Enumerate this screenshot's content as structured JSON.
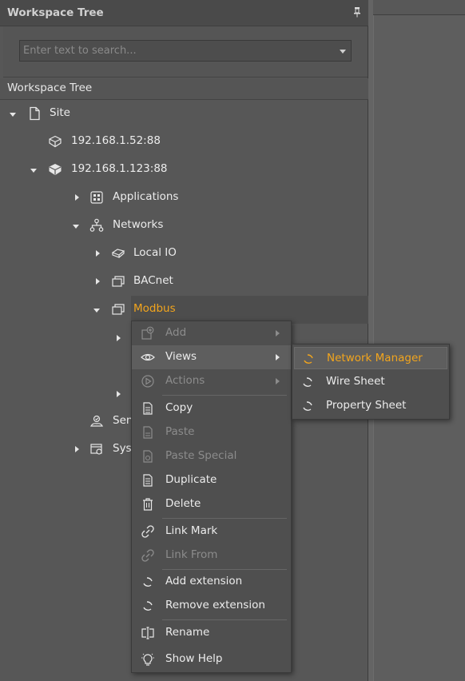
{
  "panel": {
    "title": "Workspace Tree"
  },
  "search": {
    "placeholder": "Enter text to search..."
  },
  "subheader": "Workspace Tree",
  "tree": {
    "site": "Site",
    "device1": "192.168.1.52:88",
    "device2": "192.168.1.123:88",
    "applications": "Applications",
    "networks": "Networks",
    "local_io": "Local IO",
    "bacnet": "BACnet",
    "modbus": "Modbus",
    "services_partial": "Sen",
    "system_partial": "Sys"
  },
  "context_menu": {
    "add": "Add",
    "views": "Views",
    "actions": "Actions",
    "copy": "Copy",
    "paste": "Paste",
    "paste_special": "Paste Special",
    "duplicate": "Duplicate",
    "delete": "Delete",
    "link_mark": "Link Mark",
    "link_from": "Link From",
    "add_extension": "Add extension",
    "remove_extension": "Remove extension",
    "rename": "Rename",
    "show_help": "Show Help"
  },
  "views_submenu": {
    "network_manager": "Network Manager",
    "wire_sheet": "Wire Sheet",
    "property_sheet": "Property Sheet"
  },
  "colors": {
    "accent": "#f2a51d",
    "panel": "#575757",
    "menu": "#4f4f4f"
  }
}
